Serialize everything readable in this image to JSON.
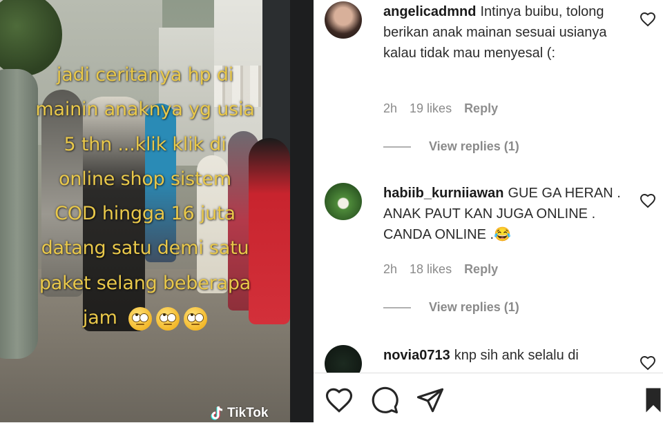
{
  "video": {
    "overlay_lines": [
      "jadi ceritanya hp di",
      "mainin anaknya yg usia",
      "5 thn ...klik klik di",
      "online shop sistem",
      "COD hingga 16 juta",
      "datang satu demi satu",
      "paket selang beberapa",
      "jam"
    ],
    "emoji": "face-with-rolling-eyes",
    "watermark": "TikTok"
  },
  "comments": [
    {
      "username": "angelicadmnd",
      "text": "Intinya buibu, tolong berikan anak mainan sesuai usianya kalau tidak mau menyesal (:",
      "time": "2h",
      "likes": "19 likes",
      "reply": "Reply",
      "view_replies": "View replies (1)"
    },
    {
      "username": "habiib_kurniiawan",
      "text": "GUE GA HERAN . ANAK PAUT KAN JUGA ONLINE . CANDA ONLINE .😂",
      "time": "2h",
      "likes": "18 likes",
      "reply": "Reply",
      "view_replies": "View replies (1)"
    },
    {
      "username": "novia0713",
      "text": "knp sih ank selalu di"
    }
  ],
  "colors": {
    "overlay_text": "#e9c84a",
    "meta_gray": "#8a8a8a"
  }
}
